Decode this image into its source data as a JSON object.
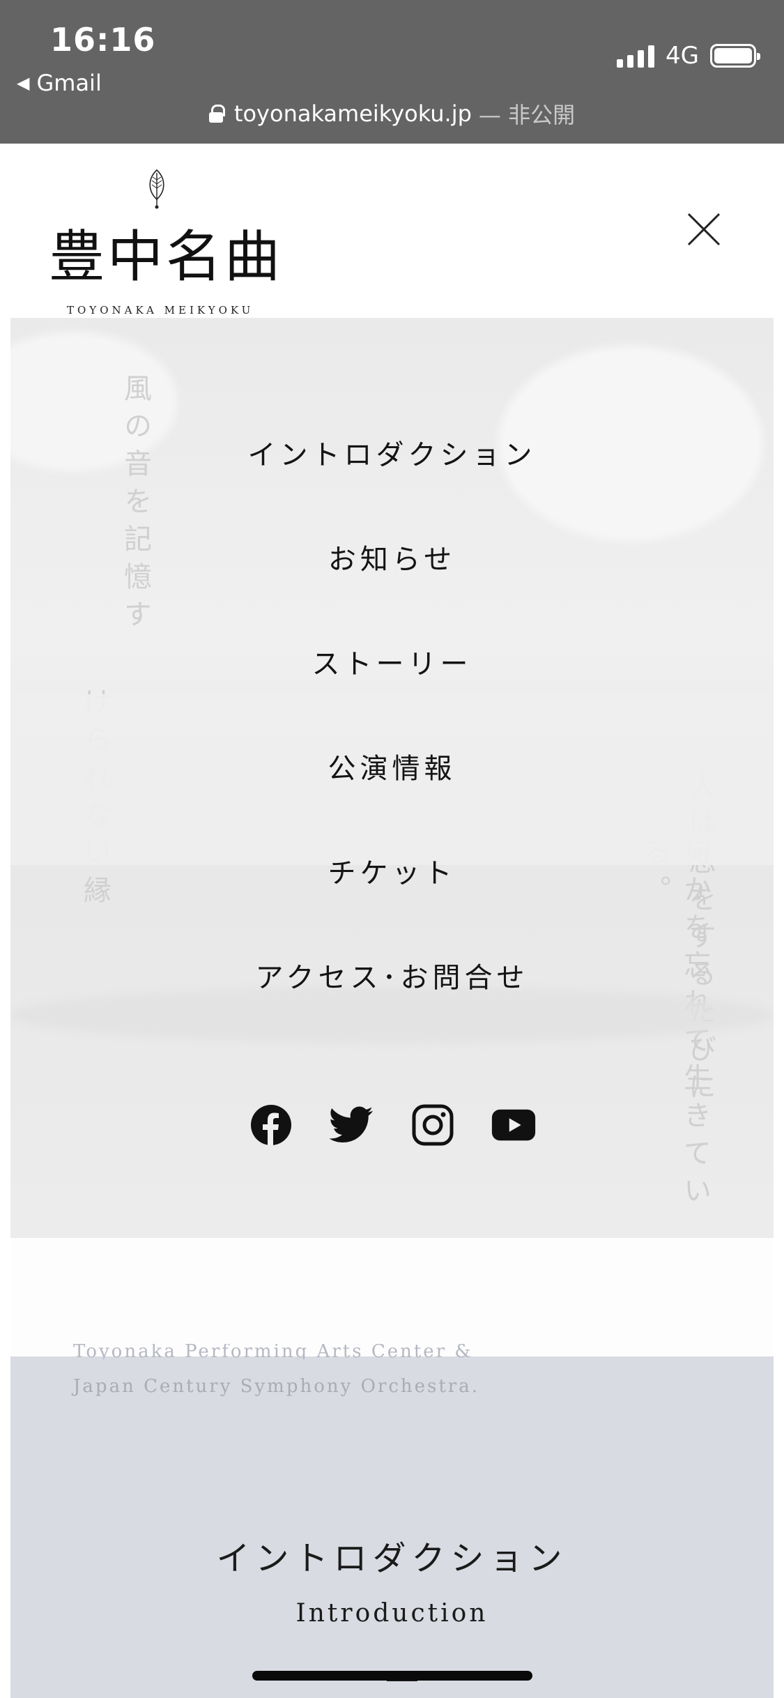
{
  "status_bar": {
    "time": "16:16",
    "back_app": "Gmail",
    "network": "4G",
    "url": "toyonakameikyoku.jp",
    "url_suffix": "— 非公開"
  },
  "header": {
    "logo_kanji": "豊中名曲",
    "logo_sub": "TOYONAKA MEIKYOKU",
    "close_icon": "close-icon"
  },
  "hero": {
    "vertical_left_1": "風の音を記憶す",
    "vertical_left_2": "けられない縁",
    "vertical_right_1": "人は恋をするたびに",
    "vertical_right_2": "何かを忘れて生きている。"
  },
  "menu": {
    "items": [
      {
        "label": "イントロダクション"
      },
      {
        "label": "お知らせ"
      },
      {
        "label": "ストーリー"
      },
      {
        "label": "公演情報"
      },
      {
        "label": "チケット"
      },
      {
        "label": "アクセス･お問合せ"
      }
    ],
    "social": [
      "facebook-icon",
      "twitter-icon",
      "instagram-icon",
      "youtube-icon"
    ]
  },
  "intro": {
    "en_partial": "Toyonaka Performing Arts Center &",
    "en_line": "Japan Century Symphony Orchestra.",
    "title": "イントロダクション",
    "subtitle": "Introduction"
  },
  "colors": {
    "status_bar_bg": "#646464",
    "intro_bg": "#d9dbe2",
    "menu_text": "#141414"
  }
}
